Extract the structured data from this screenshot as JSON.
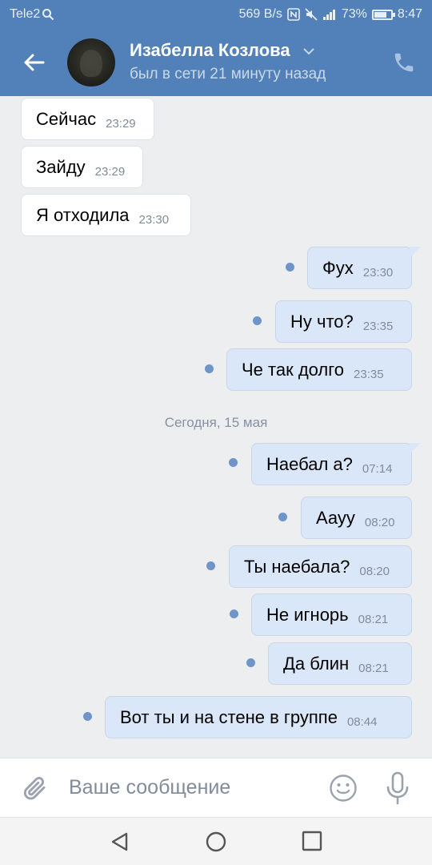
{
  "status_bar": {
    "carrier": "Tele2",
    "network_speed": "569 B/s",
    "battery": "73%",
    "battery_level": 0.73,
    "time": "8:47"
  },
  "header": {
    "contact_name": "Изабелла Козлова",
    "last_seen": "был в сети 21 минуту назад",
    "accent_color": "#5181b8"
  },
  "messages": [
    {
      "direction": "in",
      "text": "Сейчас",
      "time": "23:29"
    },
    {
      "direction": "in",
      "text": "Зайду",
      "time": "23:29"
    },
    {
      "direction": "in",
      "text": "Я отходила",
      "time": "23:30"
    },
    {
      "direction": "out",
      "text": "Фух",
      "time": "23:30"
    },
    {
      "direction": "out",
      "text": "Ну что?",
      "time": "23:35"
    },
    {
      "direction": "out",
      "text": "Че так долго",
      "time": "23:35"
    },
    {
      "direction": "out",
      "text": "Наебал а?",
      "time": "07:14"
    },
    {
      "direction": "out",
      "text": "Аауу",
      "time": "08:20"
    },
    {
      "direction": "out",
      "text": "Ты наебала?",
      "time": "08:20"
    },
    {
      "direction": "out",
      "text": "Не игнорь",
      "time": "08:21"
    },
    {
      "direction": "out",
      "text": "Да блин",
      "time": "08:21"
    },
    {
      "direction": "out",
      "text": "Вот ты и на стене в группе",
      "time": "08:44"
    }
  ],
  "date_separator": "Сегодня, 15 мая",
  "composer": {
    "placeholder": "Ваше сообщение"
  },
  "icons": {
    "back": "arrow-left",
    "phone": "phone",
    "attach": "paperclip",
    "emoji": "smile",
    "voice": "microphone",
    "nav_back": "triangle-left",
    "nav_home": "circle",
    "nav_recent": "square"
  }
}
